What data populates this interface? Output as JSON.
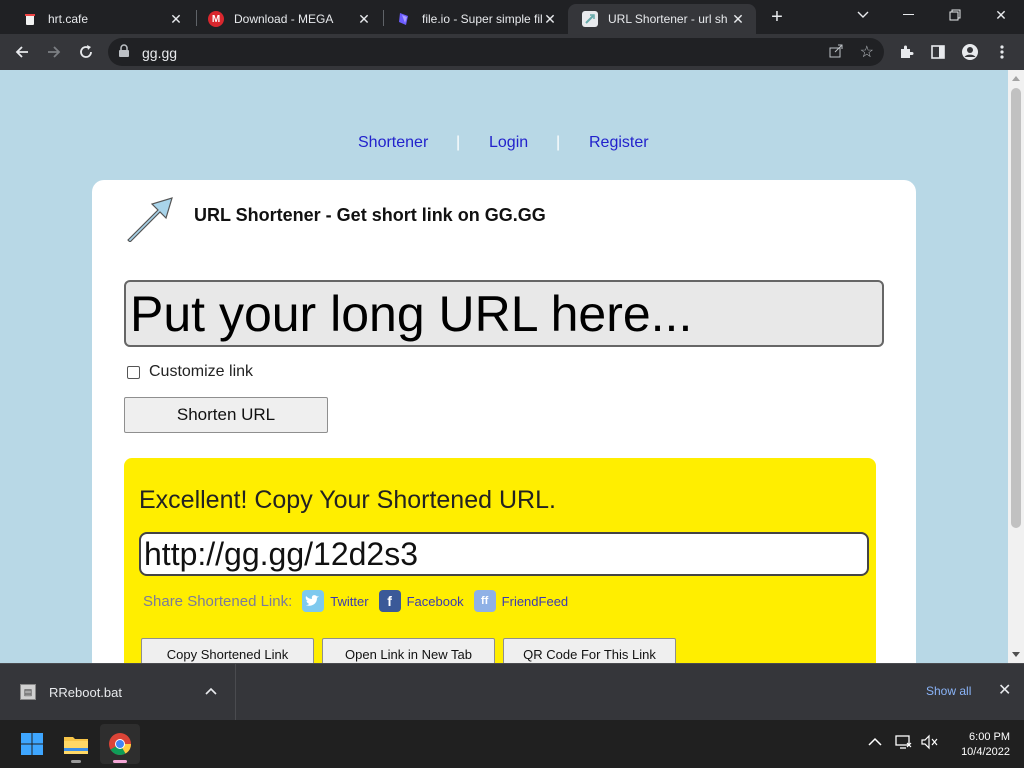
{
  "browser": {
    "tabs": [
      {
        "title": "hrt.cafe",
        "icon": "hrt-cafe-favicon"
      },
      {
        "title": "Download - MEGA",
        "icon": "mega-favicon"
      },
      {
        "title": "file.io - Super simple fil",
        "icon": "fileio-favicon"
      },
      {
        "title": "URL Shortener - url sh",
        "icon": "gg-favicon"
      }
    ],
    "address": "gg.gg"
  },
  "page": {
    "nav": {
      "shortener": "Shortener",
      "login": "Login",
      "register": "Register",
      "sep": "|"
    },
    "headline": "URL Shortener - Get short link on GG.GG",
    "url_input": {
      "placeholder": "Put your long URL here...",
      "value": ""
    },
    "customize_label": "Customize link",
    "shorten_button": "Shorten URL",
    "result": {
      "message": "Excellent! Copy Your Shortened URL.",
      "short_url": "http://gg.gg/12d2s3",
      "share_label": "Share Shortened Link:",
      "share_links": [
        "Twitter",
        "Facebook",
        "FriendFeed"
      ],
      "buttons": [
        "Copy Shortened Link",
        "Open Link in New Tab",
        "QR Code For This Link"
      ]
    }
  },
  "downloads": {
    "file": "RReboot.bat",
    "show_all": "Show all"
  },
  "taskbar": {
    "time": "6:00 PM",
    "date": "10/4/2022"
  },
  "colors": {
    "page_bg": "#b8d8e6",
    "result_bg": "#ffee00",
    "link": "#2222cc"
  }
}
